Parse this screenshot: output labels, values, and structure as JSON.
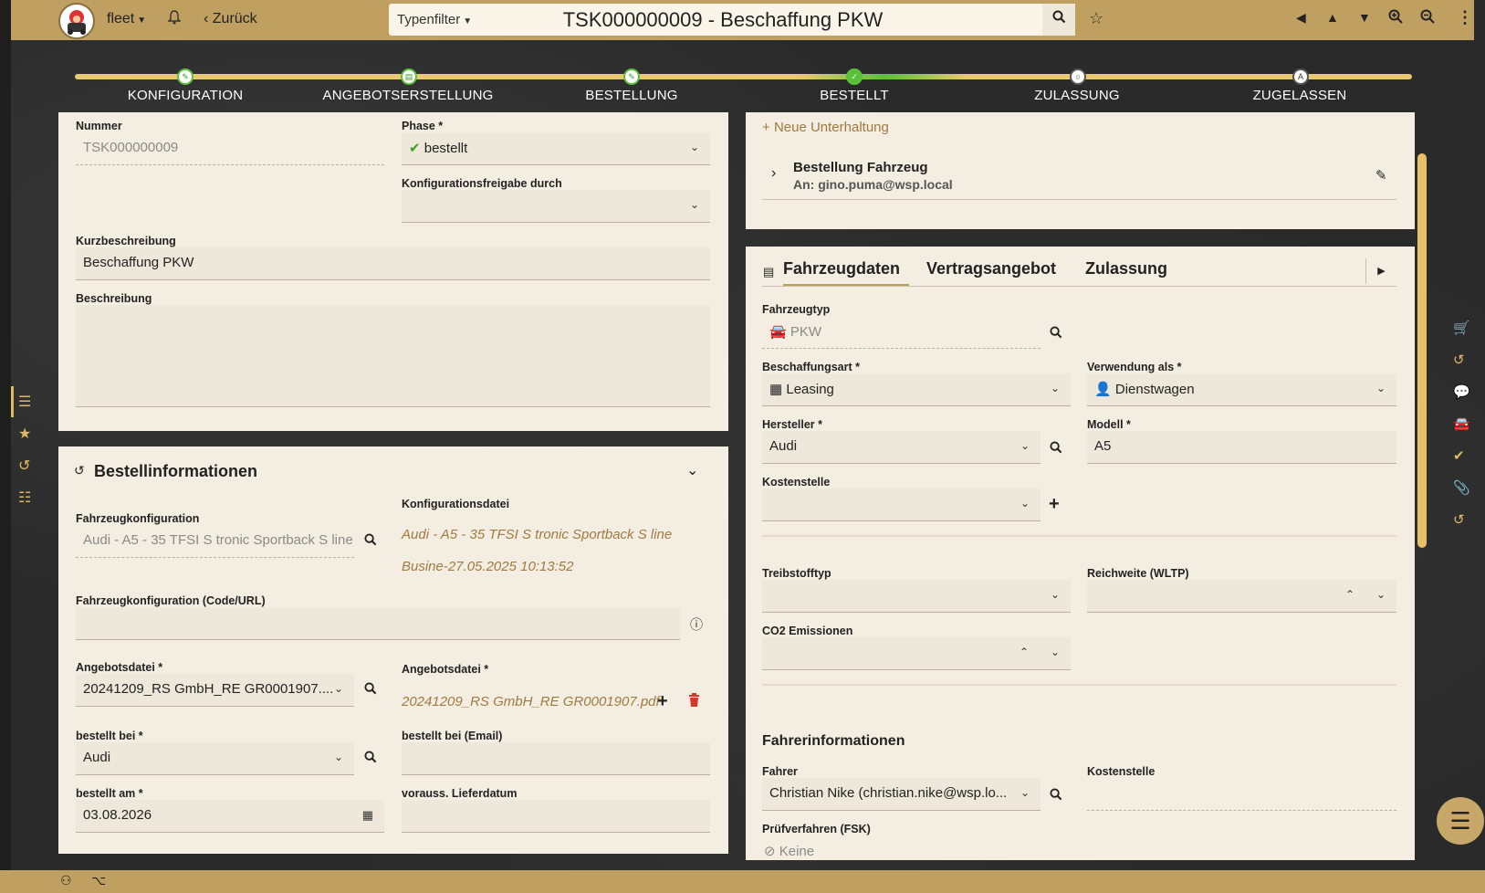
{
  "topbar": {
    "app_name": "fleet",
    "back_label": "Zurück",
    "type_filter": "Typenfilter",
    "title": "TSK000000009 - Beschaffung PKW"
  },
  "stepper": [
    {
      "label": "KONFIGURATION"
    },
    {
      "label": "ANGEBOTSERSTELLUNG"
    },
    {
      "label": "BESTELLUNG"
    },
    {
      "label": "BESTELLT"
    },
    {
      "label": "ZULASSUNG"
    },
    {
      "label": "ZUGELASSEN"
    }
  ],
  "main": {
    "nummer_label": "Nummer",
    "nummer_value": "TSK000000009",
    "phase_label": "Phase *",
    "phase_value": "bestellt",
    "konfig_freigabe_label": "Konfigurationsfreigabe durch",
    "kurzbeschreibung_label": "Kurzbeschreibung",
    "kurzbeschreibung_value": "Beschaffung PKW",
    "beschreibung_label": "Beschreibung"
  },
  "bestell": {
    "title": "Bestellinformationen",
    "konfig_datei_label": "Konfigurationsdatei",
    "konfig_datei_line1": "Audi - A5 - 35 TFSI S tronic Sportback S line",
    "konfig_datei_line2": "Busine-27.05.2025 10:13:52",
    "fahrzeugkonfig_label": "Fahrzeugkonfiguration",
    "fahrzeugkonfig_value": "Audi - A5 - 35 TFSI S tronic Sportback S line ...",
    "fahrzeugkonfig_url_label": "Fahrzeugkonfiguration (Code/URL)",
    "angebotsdatei_label": "Angebotsdatei *",
    "angebotsdatei_value": "20241209_RS GmbH_RE GR0001907....",
    "angebotsdatei2_label": "Angebotsdatei *",
    "angebotsdatei2_link": "20241209_RS GmbH_RE GR0001907.pdf",
    "bestellt_bei_label": "bestellt bei *",
    "bestellt_bei_value": "Audi",
    "bestellt_bei_email_label": "bestellt bei (Email)",
    "bestellt_am_label": "bestellt am *",
    "bestellt_am_value": "03.08.2026",
    "lieferdatum_label": "vorauss. Lieferdatum"
  },
  "conversation": {
    "new_label": "Neue Unterhaltung",
    "item_title": "Bestellung Fahrzeug",
    "item_sub": "An: gino.puma@wsp.local"
  },
  "vehicle": {
    "tabs": [
      "Fahrzeugdaten",
      "Vertragsangebot",
      "Zulassung"
    ],
    "fahrzeugtyp_label": "Fahrzeugtyp",
    "fahrzeugtyp_value": "PKW",
    "beschaffungsart_label": "Beschaffungsart *",
    "beschaffungsart_value": "Leasing",
    "verwendung_label": "Verwendung als *",
    "verwendung_value": "Dienstwagen",
    "hersteller_label": "Hersteller *",
    "hersteller_value": "Audi",
    "modell_label": "Modell *",
    "modell_value": "A5",
    "kostenstelle_label": "Kostenstelle",
    "treibstoff_label": "Treibstofftyp",
    "reichweite_label": "Reichweite (WLTP)",
    "co2_label": "CO2 Emissionen",
    "fahrer_section": "Fahrerinformationen",
    "fahrer_label": "Fahrer",
    "fahrer_value": "Christian Nike (christian.nike@wsp.lo...",
    "fahrer_kostenstelle_label": "Kostenstelle",
    "pruef_label": "Prüfverfahren (FSK)",
    "pruef_value": "Keine"
  },
  "colors": {
    "accent": "#c0a060",
    "success": "#5bc03a",
    "delete": "#d03a2a",
    "link": "#a07a40"
  }
}
